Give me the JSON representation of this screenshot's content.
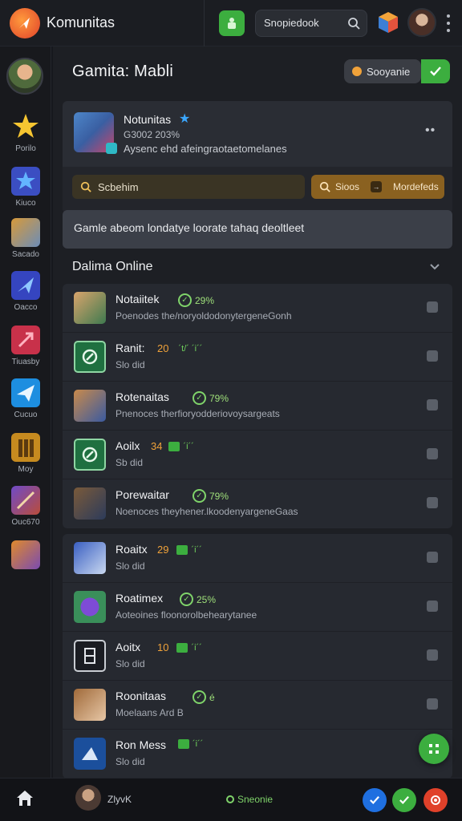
{
  "app": {
    "title": "Komunitas",
    "logo_icon": "app-logo-icon",
    "accent_green": "#3cae3f",
    "accent_orange": "#f0a23a"
  },
  "topbar": {
    "search_value": "Snopiedook",
    "icons": [
      "green-square-icon",
      "search-icon",
      "cube-icon",
      "avatar",
      "kebab-icon"
    ]
  },
  "sidebar": {
    "items": [
      {
        "label": "Porilo",
        "icon": "star-icon"
      },
      {
        "label": "Kiuco",
        "icon": "star-badge-icon"
      },
      {
        "label": "Sacado",
        "icon": "game-art-icon"
      },
      {
        "label": "Oacco",
        "icon": "plane-icon"
      },
      {
        "label": "Tiuasby",
        "icon": "pin-icon"
      },
      {
        "label": "Cucuo",
        "icon": "paper-plane-icon"
      },
      {
        "label": "Moy",
        "icon": "tower-icon"
      },
      {
        "label": "Ouc670",
        "icon": "sword-icon"
      },
      {
        "label": "",
        "icon": "game-art-icon"
      }
    ]
  },
  "header": {
    "title": "Gamita: Mabli",
    "button_label": "Sooyanie"
  },
  "profile": {
    "name": "Notunitas",
    "stat": "G3002 203%",
    "description": "Aysenc ehd afeingraotaetomelanes",
    "search_label": "Scbehim",
    "action_label": "Sioos",
    "action_label_2": "Mordefeds"
  },
  "notice": {
    "text": "Gamle abeom londatye loorate tahaq deoltleet"
  },
  "section": {
    "title": "Dalima Online"
  },
  "online_list": [
    {
      "name": "Notaiitek",
      "status": "29%",
      "subtitle": "Poenodes the/noryoldodonytergeneGonh"
    },
    {
      "name": "Ranit:",
      "num": "20",
      "extra": "´t/´ ´i´´",
      "subtitle": "Slo did"
    },
    {
      "name": "Rotenaitas",
      "status": "79%",
      "subtitle": "Pnenoces therfioryodderiovoysargeats"
    },
    {
      "name": "Aoilx",
      "num": "34",
      "extra": "´i´´",
      "subtitle": "Sb did"
    },
    {
      "name": "Porewaitar",
      "status": "79%",
      "subtitle": "Noenoces theyhener.lkoodenyargeneGaas"
    }
  ],
  "friend_list": [
    {
      "name": "Roaitx",
      "num": "29",
      "extra": "´i´´",
      "subtitle": "Slo did"
    },
    {
      "name": "Roatimex",
      "status": "25%",
      "subtitle": "Aoteoines  floonorolbehearytanee"
    },
    {
      "name": "Aoitx",
      "num": "10",
      "extra": "´i´´",
      "subtitle": "Slo did"
    },
    {
      "name": "Roonitaas",
      "status": "é",
      "subtitle": "Moelaans Ard  B"
    },
    {
      "name": "Ron Mess",
      "extra": "´i´´",
      "subtitle": "Slo did"
    }
  ],
  "bottombar": {
    "user": "ZlyvK",
    "status": "Sneonie",
    "home_icon": "home-icon"
  }
}
